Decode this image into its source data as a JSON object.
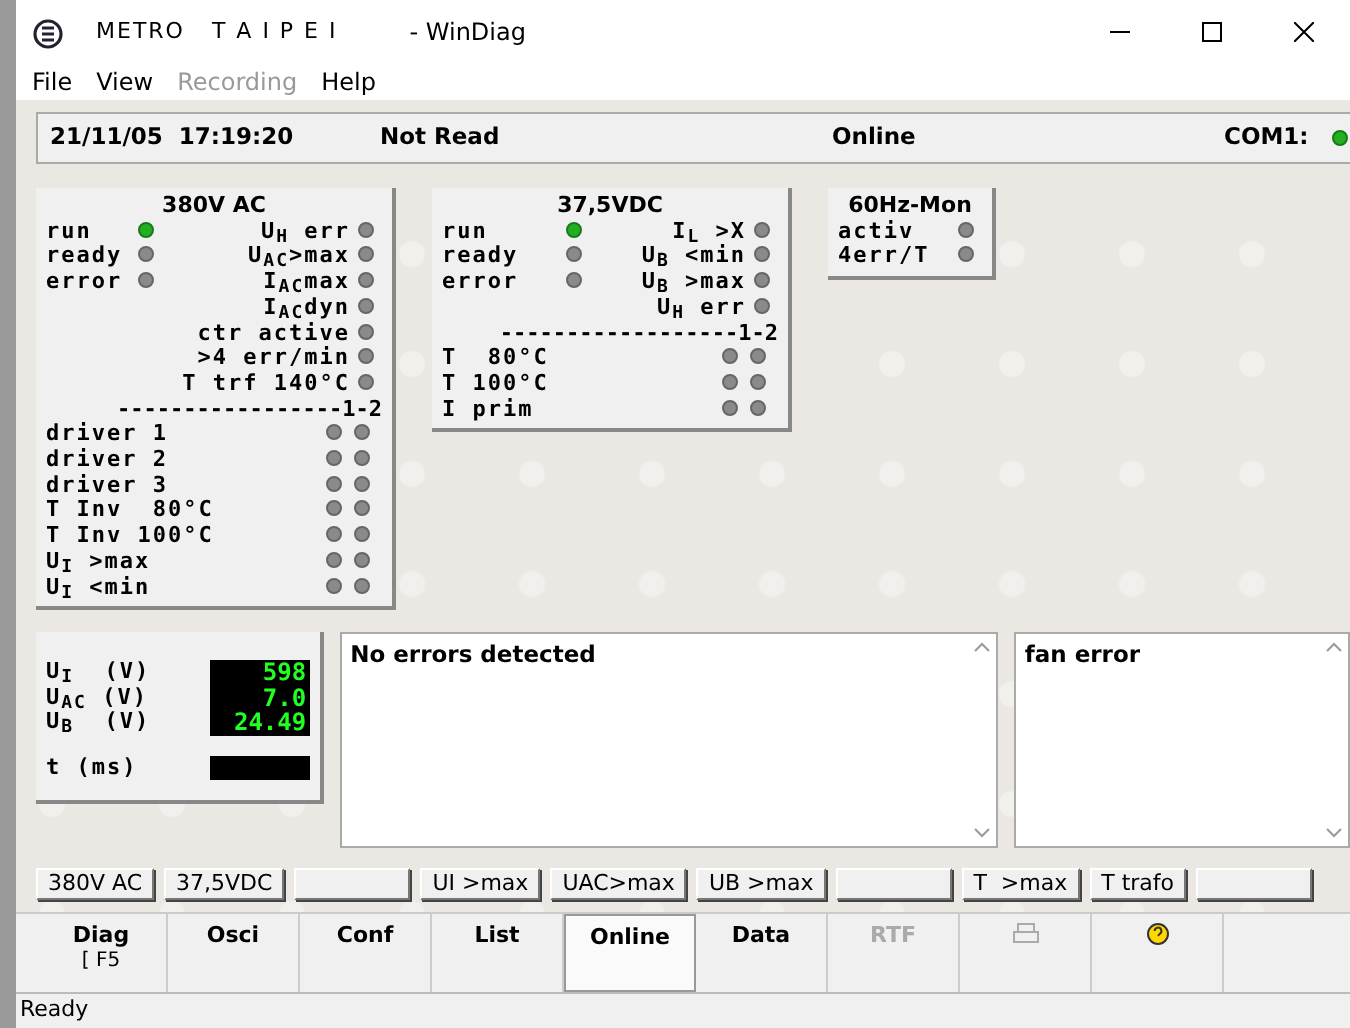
{
  "window": {
    "title_brand": "METRO   T A I P E I",
    "title": "- WinDiag"
  },
  "menu": [
    {
      "label": "File",
      "disabled": false
    },
    {
      "label": "View",
      "disabled": false
    },
    {
      "label": "Recording",
      "disabled": true
    },
    {
      "label": "Help",
      "disabled": false
    }
  ],
  "info_bar": {
    "datetime": "21/11/05  17:19:20",
    "read_state": "Not Read",
    "connection": "Online",
    "port": "COM1:",
    "port_on": true
  },
  "panels": [
    {
      "title": "380V AC",
      "status": [
        {
          "label": "run",
          "on": true
        },
        {
          "label": "ready",
          "on": false
        },
        {
          "label": "error",
          "on": false
        }
      ],
      "signals": [
        {
          "label": "U$_{H}$ err",
          "on": false
        },
        {
          "label": "U$_{AC}$>max",
          "on": false
        },
        {
          "label": "I$_{AC}$max",
          "on": false
        },
        {
          "label": "I$_{AC}$dyn",
          "on": false
        },
        {
          "label": "ctr active",
          "on": false
        },
        {
          "label": ">4 err/min",
          "on": false
        },
        {
          "label": "T trf 140°C",
          "on": false
        }
      ],
      "divider": "-----------------1-2",
      "channels": [
        {
          "label": "driver 1",
          "leds": [
            false,
            false
          ]
        },
        {
          "label": "driver 2",
          "leds": [
            false,
            false
          ]
        },
        {
          "label": "driver 3",
          "leds": [
            false,
            false
          ]
        },
        {
          "label": "T Inv  80°C",
          "leds": [
            false,
            false
          ]
        },
        {
          "label": "T Inv 100°C",
          "leds": [
            false,
            false
          ]
        },
        {
          "label": "U$_{I}$ >max",
          "leds": [
            false,
            false
          ]
        },
        {
          "label": "U$_{I}$ <min",
          "leds": [
            false,
            false
          ]
        }
      ]
    },
    {
      "title": "37,5VDC",
      "status": [
        {
          "label": "run",
          "on": true
        },
        {
          "label": "ready",
          "on": false
        },
        {
          "label": "error",
          "on": false
        }
      ],
      "signals": [
        {
          "label": "I$_{L}$ >X",
          "on": false
        },
        {
          "label": "U$_{B}$ <min",
          "on": false
        },
        {
          "label": "U$_{B}$ >max",
          "on": false
        },
        {
          "label": "U$_{H}$ err",
          "on": false
        }
      ],
      "divider": "------------------1-2",
      "channels": [
        {
          "label": "T  80°C",
          "leds": [
            false,
            false
          ]
        },
        {
          "label": "T 100°C",
          "leds": [
            false,
            false
          ]
        },
        {
          "label": "I prim",
          "leds": [
            false,
            false
          ]
        }
      ]
    },
    {
      "title": "60Hz-Mon",
      "signals": [
        {
          "label": "activ",
          "on": false
        },
        {
          "label": "4err/T",
          "on": false
        }
      ]
    }
  ],
  "readings": [
    {
      "label": "U$_{I}$  (V)",
      "value": "598"
    },
    {
      "label": "U$_{AC}$ (V)",
      "value": "7.0"
    },
    {
      "label": "U$_{B}$  (V)",
      "value": "24.49"
    }
  ],
  "timer": {
    "label": "t (ms)"
  },
  "error_list": {
    "text": "No errors detected"
  },
  "warning_list": {
    "text": "fan error"
  },
  "signal_buttons": [
    {
      "label": "380V AC"
    },
    {
      "label": "37,5VDC"
    },
    {
      "kind": "blank"
    },
    {
      "label": "UI >max"
    },
    {
      "label": "UAC>max"
    },
    {
      "label": "UB >max"
    },
    {
      "kind": "blank"
    },
    {
      "label": "T  >max"
    },
    {
      "label": "T trafo"
    },
    {
      "kind": "blank"
    }
  ],
  "toolbar": [
    {
      "kind": "text",
      "label": "Diag",
      "hint": "[ F5",
      "selected": false,
      "disabled": false
    },
    {
      "kind": "text",
      "label": "Osci",
      "selected": false,
      "disabled": false
    },
    {
      "kind": "text",
      "label": "Conf",
      "selected": false,
      "disabled": false
    },
    {
      "kind": "text",
      "label": "List",
      "selected": false,
      "disabled": false
    },
    {
      "kind": "text",
      "label": "Online",
      "selected": true,
      "disabled": false
    },
    {
      "kind": "text",
      "label": "Data",
      "selected": false,
      "disabled": false
    },
    {
      "kind": "text",
      "label": "RTF",
      "selected": false,
      "disabled": true
    },
    {
      "kind": "print",
      "selected": false,
      "disabled": true
    },
    {
      "kind": "help",
      "selected": false,
      "disabled": false
    }
  ],
  "status_bar": {
    "text": "Ready"
  }
}
